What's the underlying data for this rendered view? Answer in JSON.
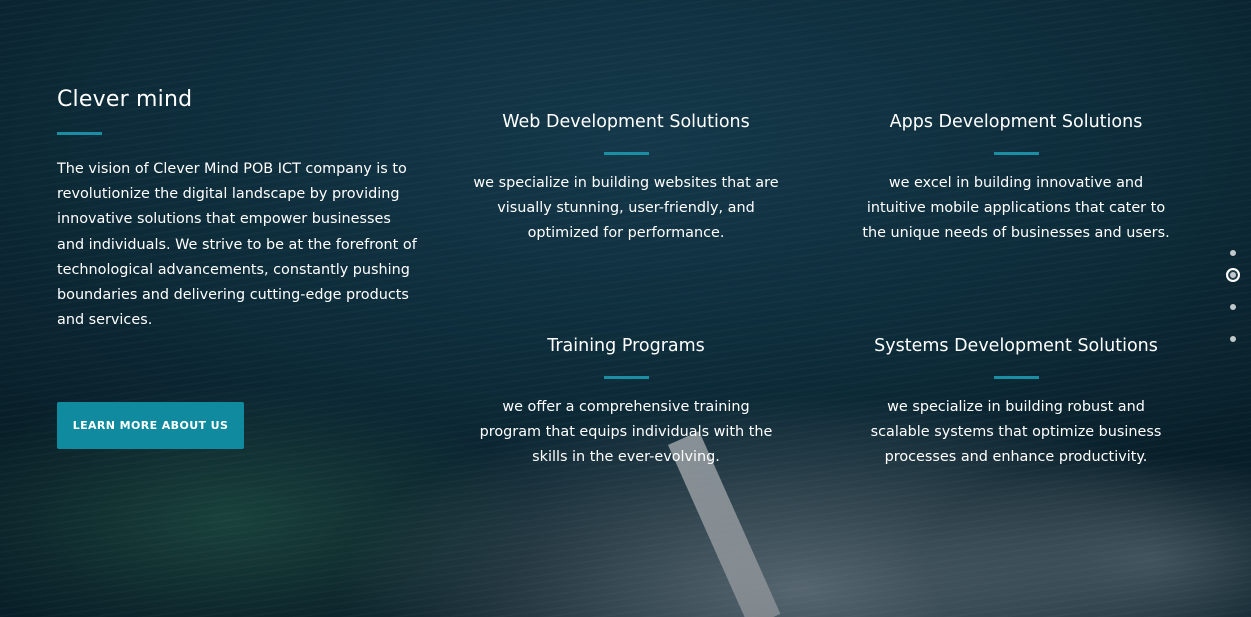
{
  "about": {
    "title": "Clever mind",
    "text": "The vision of Clever Mind POB ICT company is to revolutionize the digital landscape by providing innovative solutions that empower businesses and individuals. We strive to be at the forefront of technological advancements, constantly pushing boundaries and delivering cutting-edge products and services.",
    "button_label": "LEARN MORE ABOUT US"
  },
  "services": [
    {
      "title": "Web Development Solutions",
      "text": "we specialize in building websites that are visually stunning, user-friendly, and optimized for performance."
    },
    {
      "title": "Apps Development Solutions",
      "text": "we excel in building innovative and intuitive mobile applications that cater to the unique needs of businesses and users."
    },
    {
      "title": "Training Programs",
      "text": "we offer a comprehensive training program that equips individuals with the skills in the ever-evolving."
    },
    {
      "title": "Systems Development Solutions",
      "text": "we specialize in building robust and scalable systems that optimize business processes and enhance productivity."
    }
  ],
  "section_nav": {
    "count": 4,
    "active_index": 1
  },
  "colors": {
    "accent": "#0f8a9e",
    "underline": "#1a8ea3",
    "background": "#0d2c3a"
  }
}
